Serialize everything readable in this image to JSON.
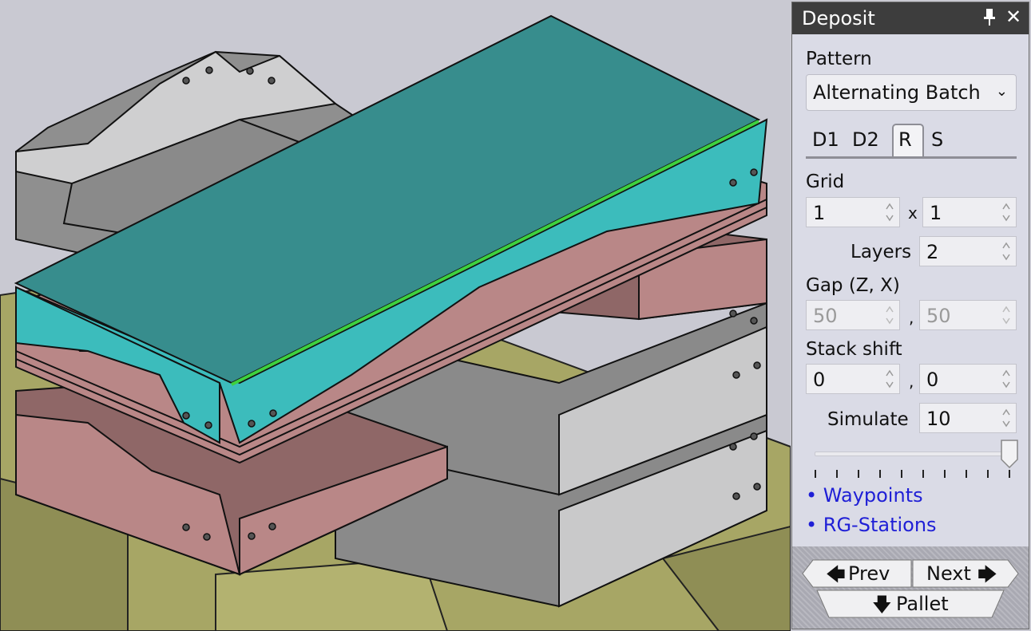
{
  "panel": {
    "title": "Deposit",
    "pattern_label": "Pattern",
    "pattern_value": "Alternating Batch",
    "tabs": [
      "D1",
      "D2",
      "R",
      "S"
    ],
    "active_tab": "R",
    "grid_label": "Grid",
    "grid_x": "1",
    "grid_sep": "x",
    "grid_y": "1",
    "layers_label": "Layers",
    "layers_value": "2",
    "gap_label": "Gap (Z, X)",
    "gap_z": "50",
    "gap_sep": ",",
    "gap_x": "50",
    "shift_label": "Stack shift",
    "shift_a": "0",
    "shift_sep": ",",
    "shift_b": "0",
    "simulate_label": "Simulate",
    "simulate_value": "10",
    "slider_value": 1.0,
    "links": [
      "• Waypoints",
      "• RG-Stations"
    ],
    "prev_label": "Prev",
    "next_label": "Next",
    "pallet_label": "Pallet"
  },
  "colors": {
    "background": "#c9c9d2",
    "panel_bg": "#dadbe6",
    "titlebar": "#3d3d3d",
    "teal_top": "#378d8d",
    "teal_side": "#3cbcbc",
    "pink": "#b98787",
    "gray_part": "#8f8f8f",
    "pallet": "#a7a665",
    "link": "#1f1fd6"
  }
}
